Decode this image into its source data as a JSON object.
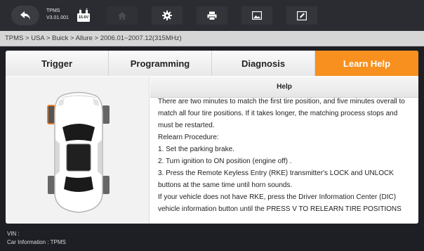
{
  "app": {
    "name": "TPMS",
    "version": "V3.01.001",
    "voltage": "15.6V"
  },
  "toolbar": {
    "icons": [
      "home-icon",
      "gear-icon",
      "printer-icon",
      "image-icon",
      "edit-icon"
    ]
  },
  "breadcrumb": "TPMS > USA > Buick > Allure > 2006.01~2007.12(315MHz)",
  "tabs": [
    {
      "label": "Trigger",
      "active": false
    },
    {
      "label": "Programming",
      "active": false
    },
    {
      "label": "Diagnosis",
      "active": false
    },
    {
      "label": "Learn Help",
      "active": true
    }
  ],
  "colors": {
    "accent": "#f7901e",
    "highlight_tire": "#e87722"
  },
  "help": {
    "title": "Help",
    "lines": [
      "There are two minutes to match the first tire position, and five minutes overall to match all four tire positions. If it takes longer, the matching process stops and must be restarted.",
      "Relearn Procedure:",
      "1. Set the parking brake.",
      "2. Turn ignition to ON position (engine off) .",
      "3. Press the Remote Keyless Entry (RKE) transmitter's LOCK and UNLOCK buttons at the same time until horn sounds.",
      "If your vehicle does not have RKE, press the Driver Information Center (DIC) vehicle information button until the PRESS V TO RELEARN TIRE POSITIONS"
    ]
  },
  "footer": {
    "vin_label": "VIN :",
    "car_info": "Car Information : TPMS"
  }
}
